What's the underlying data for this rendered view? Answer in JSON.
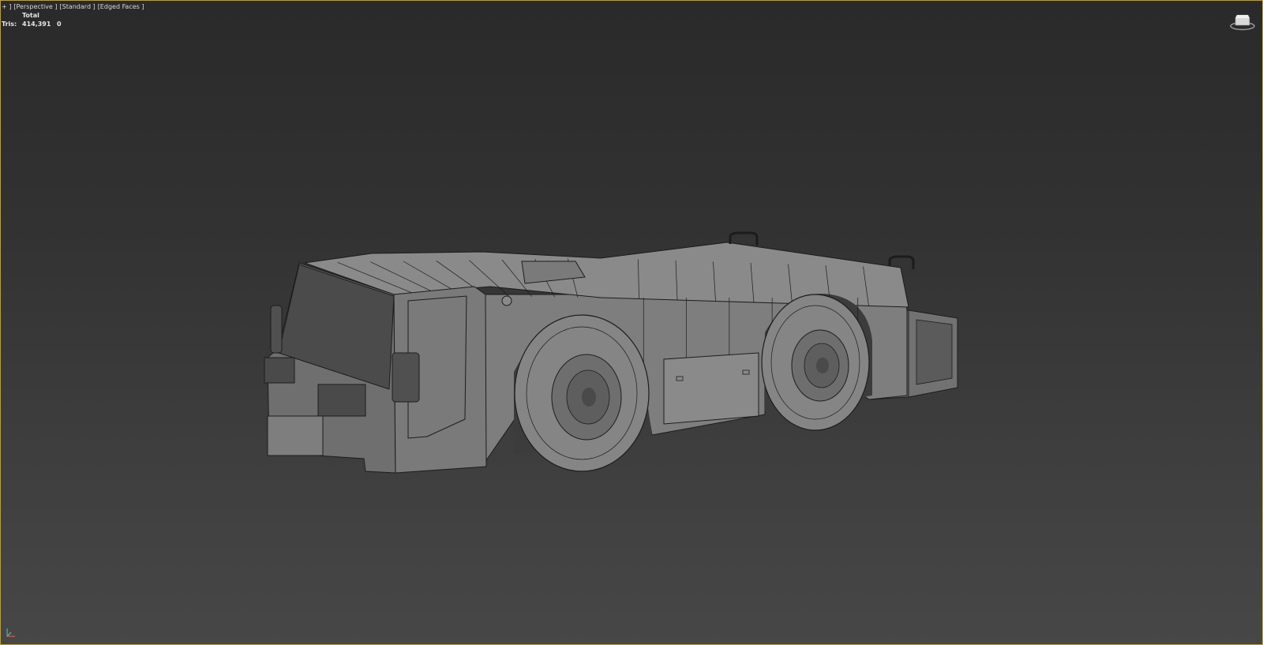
{
  "viewport": {
    "labels": [
      "+ ]",
      "[Perspective ]",
      "[Standard ]",
      "[Edged Faces ]"
    ],
    "stats": {
      "header": "Total",
      "row_label": "Tris:",
      "total_value": "414,391",
      "selected_value": "0"
    },
    "icons": [
      "viewcube-icon",
      "axis-tripod-icon"
    ],
    "colors": {
      "frame": "#b8a13a",
      "background_top": "#2a2a2a",
      "background_bottom": "#474747",
      "mesh": "#7d7d7d",
      "wire": "#1c1c1c"
    }
  }
}
